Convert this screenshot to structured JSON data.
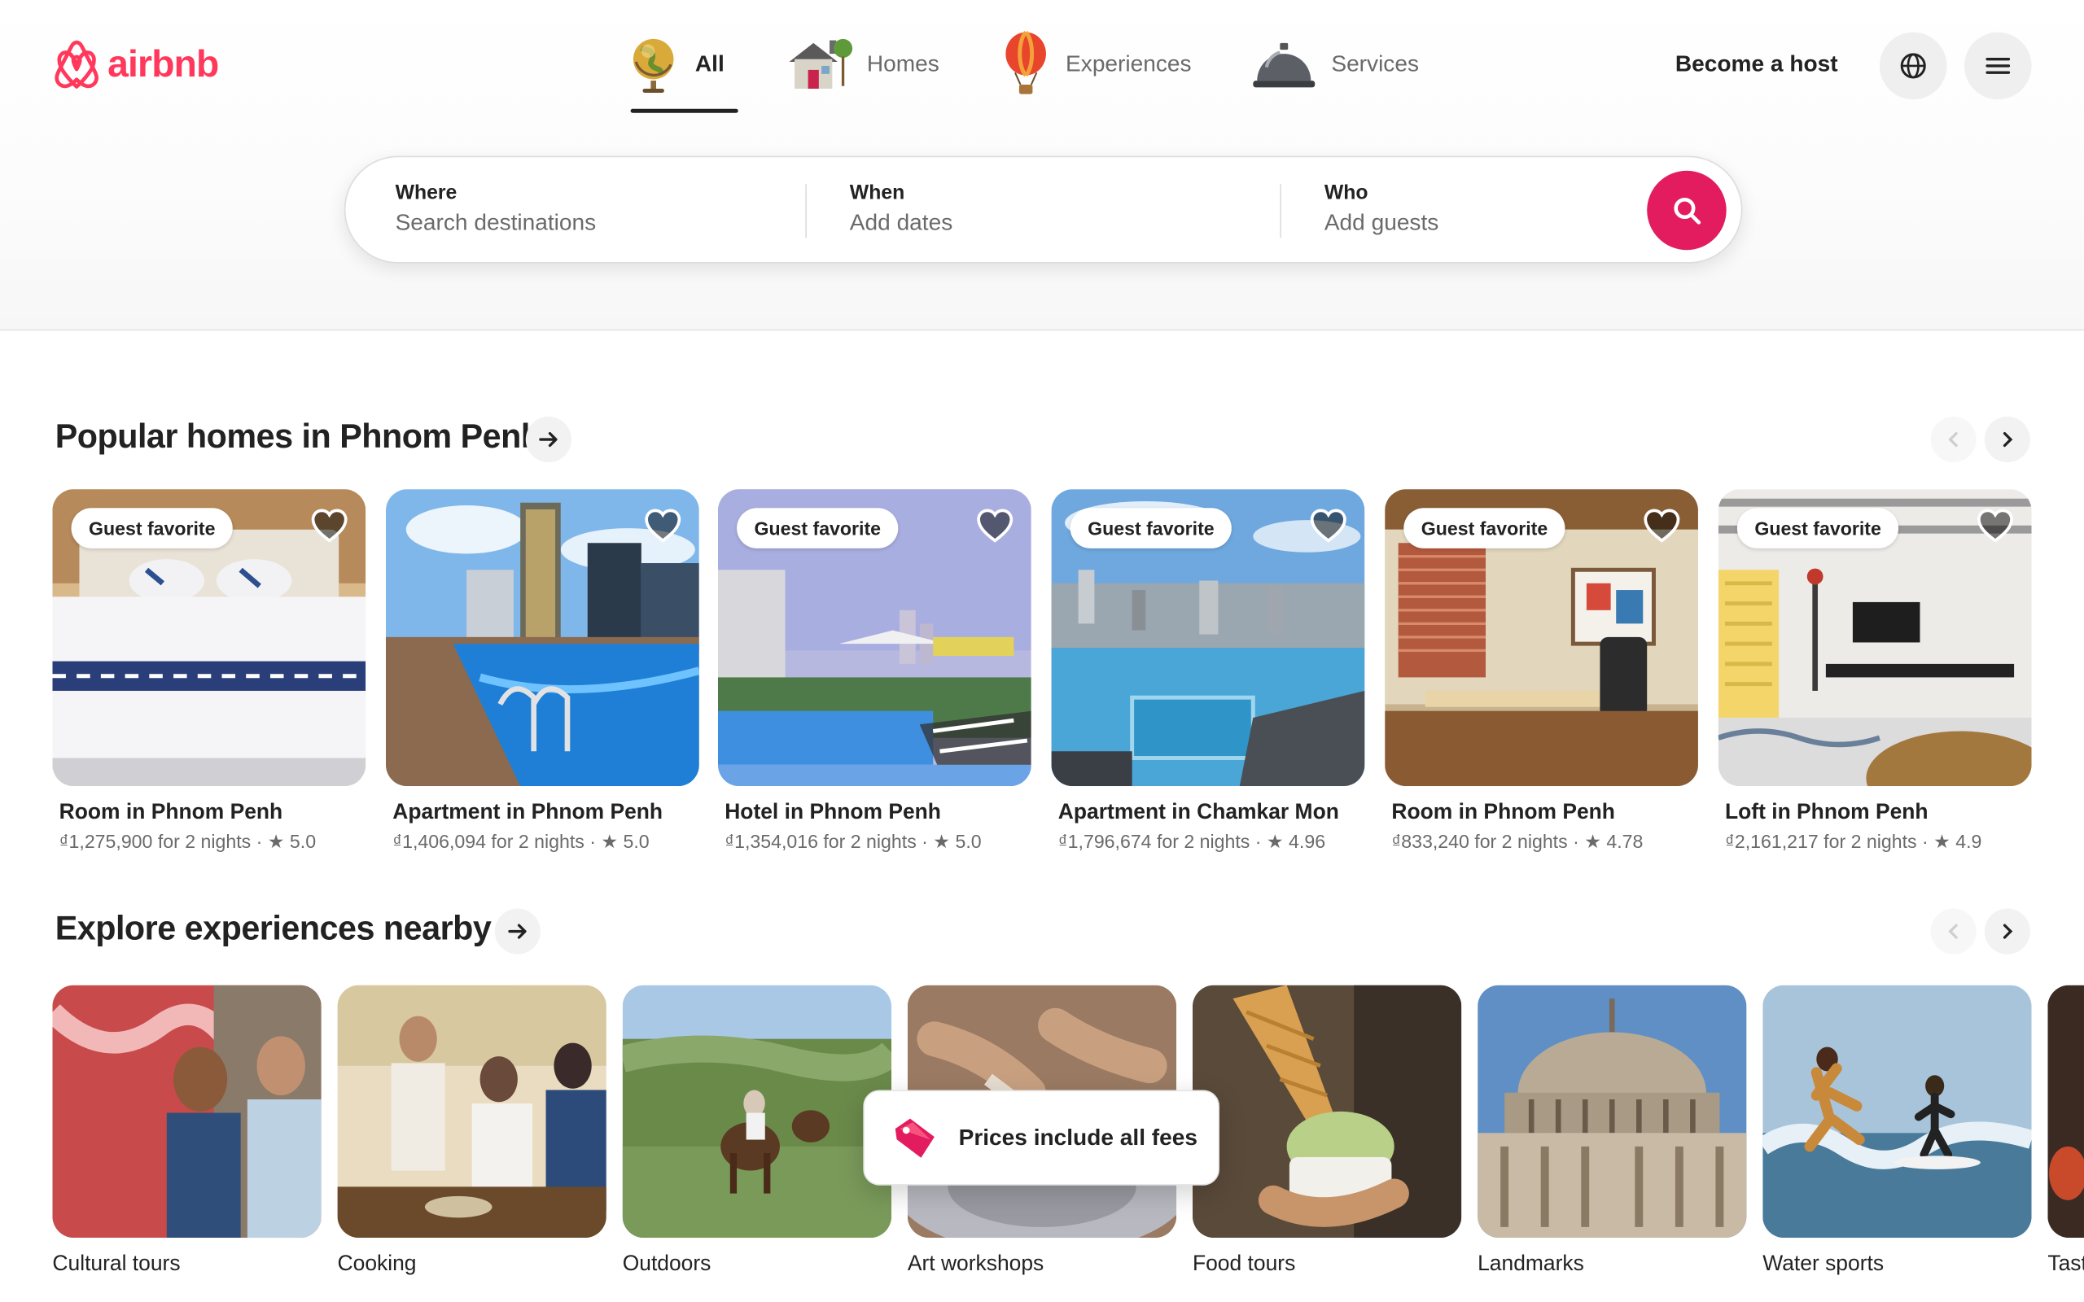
{
  "brand": {
    "name": "airbnb",
    "color": "#FF385C"
  },
  "nav": {
    "categories": [
      {
        "label": "All",
        "icon": "globe-icon",
        "active": true
      },
      {
        "label": "Homes",
        "icon": "house-icon",
        "active": false
      },
      {
        "label": "Experiences",
        "icon": "hot-air-balloon-icon",
        "active": false
      },
      {
        "label": "Services",
        "icon": "service-bell-icon",
        "active": false
      }
    ],
    "become_host": "Become a host",
    "globe_button_icon": "language-globe-icon",
    "menu_button_icon": "hamburger-menu-icon"
  },
  "search": {
    "where_label": "Where",
    "where_placeholder": "Search destinations",
    "when_label": "When",
    "when_placeholder": "Add dates",
    "who_label": "Who",
    "who_placeholder": "Add guests",
    "button_icon": "search-icon",
    "button_color": "#E31C5F"
  },
  "popular": {
    "title": "Popular homes in Phnom Penh",
    "listings": [
      {
        "title": "Room in Phnom Penh",
        "price_line": "₫1,275,900 for 2 nights · ★ 5.0",
        "badge": "Guest favorite"
      },
      {
        "title": "Apartment in Phnom Penh",
        "price_line": "₫1,406,094 for 2 nights · ★ 5.0",
        "badge": ""
      },
      {
        "title": "Hotel in Phnom Penh",
        "price_line": "₫1,354,016 for 2 nights · ★ 5.0",
        "badge": "Guest favorite"
      },
      {
        "title": "Apartment in Chamkar Mon",
        "price_line": "₫1,796,674 for 2 nights · ★ 4.96",
        "badge": "Guest favorite"
      },
      {
        "title": "Room in Phnom Penh",
        "price_line": "₫833,240 for 2 nights · ★ 4.78",
        "badge": "Guest favorite"
      },
      {
        "title": "Loft in Phnom Penh",
        "price_line": "₫2,161,217 for 2 nights · ★ 4.9",
        "badge": "Guest favorite"
      }
    ]
  },
  "experiences": {
    "title": "Explore experiences nearby",
    "items": [
      {
        "label": "Cultural tours"
      },
      {
        "label": "Cooking"
      },
      {
        "label": "Outdoors"
      },
      {
        "label": "Art workshops"
      },
      {
        "label": "Food tours"
      },
      {
        "label": "Landmarks"
      },
      {
        "label": "Water sports"
      },
      {
        "label": "Tast"
      }
    ]
  },
  "toast": {
    "text": "Prices include all fees",
    "icon": "price-tag-icon"
  }
}
